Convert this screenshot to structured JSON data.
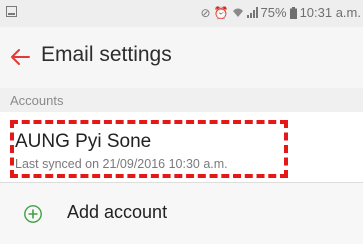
{
  "status_bar": {
    "battery": "75%",
    "time": "10:31 a.m.",
    "icons": [
      "notification-icon",
      "mute-icon",
      "alarm-icon",
      "wifi-icon",
      "signal-icon",
      "battery-icon"
    ]
  },
  "header": {
    "title": "Email settings",
    "back_icon": "back-arrow-icon",
    "accent_color": "#e53935"
  },
  "accounts_section": {
    "label": "Accounts",
    "items": [
      {
        "name": "AUNG Pyi Sone",
        "last_synced": "Last synced on 21/09/2016  10:30 a.m."
      }
    ]
  },
  "add_account": {
    "label": "Add account",
    "icon": "plus-icon",
    "icon_color": "#43a047"
  },
  "highlight_color": "#e51717"
}
